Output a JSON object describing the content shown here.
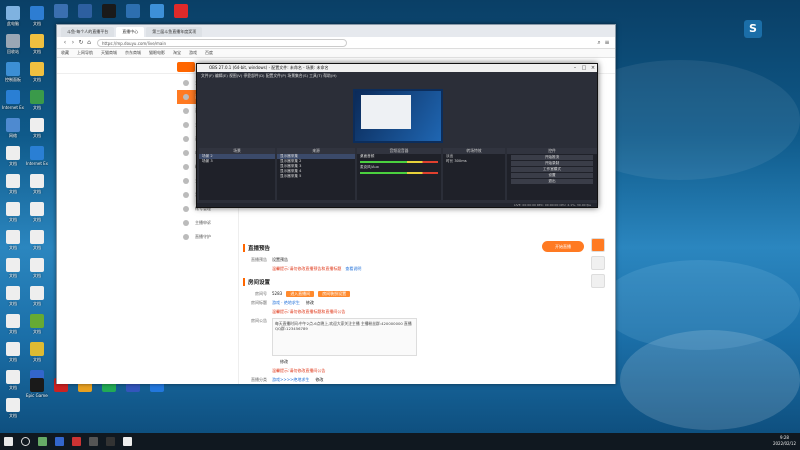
{
  "desktop": {
    "icons": [
      {
        "label": "此电脑",
        "color": "#7fb2e0"
      },
      {
        "label": "回收站",
        "color": "#9aa7b5"
      },
      {
        "label": "控制面板",
        "color": "#3c8fd4"
      },
      {
        "label": "Internet Explorer",
        "color": "#2a7fd4"
      },
      {
        "label": "网络",
        "color": "#4e8ad0"
      },
      {
        "label": "文档",
        "color": "#eeeeee"
      },
      {
        "label": "文档",
        "color": "#eeeeee"
      },
      {
        "label": "文档",
        "color": "#eeeeee"
      },
      {
        "label": "文档",
        "color": "#eeeeee"
      },
      {
        "label": "文档",
        "color": "#eeeeee"
      },
      {
        "label": "文档",
        "color": "#eeeeee"
      },
      {
        "label": "文档",
        "color": "#eeeeee"
      },
      {
        "label": "文档",
        "color": "#eeeeee"
      },
      {
        "label": "文档",
        "color": "#eeeeee"
      },
      {
        "label": "文档",
        "color": "#eeeeee"
      }
    ],
    "col2_icons": [
      {
        "label": "文档",
        "color": "#2d7dd2"
      },
      {
        "label": "文档",
        "color": "#f0c040"
      },
      {
        "label": "文档",
        "color": "#f0c040"
      },
      {
        "label": "文档",
        "color": "#3a9a4a"
      },
      {
        "label": "文档",
        "color": "#eeeeee"
      },
      {
        "label": "Internet Explorer",
        "color": "#2a7fd4"
      },
      {
        "label": "文档",
        "color": "#eeeeee"
      },
      {
        "label": "文档",
        "color": "#eeeeee"
      },
      {
        "label": "文档",
        "color": "#eeeeee"
      },
      {
        "label": "文档",
        "color": "#eeeeee"
      },
      {
        "label": "文档",
        "color": "#eeeeee"
      },
      {
        "label": "文档",
        "color": "#66aa33"
      },
      {
        "label": "文档",
        "color": "#ddbb33"
      },
      {
        "label": "文档",
        "color": "#3366cc"
      }
    ],
    "top_icons": [
      {
        "label": "",
        "color": "#3a6fb0"
      },
      {
        "label": "",
        "color": "#2d5fa0"
      },
      {
        "label": "",
        "color": "#1a1a1a"
      },
      {
        "label": "",
        "color": "#2d6fb0"
      },
      {
        "label": "",
        "color": "#3d90d8"
      },
      {
        "label": "",
        "color": "#e02a2a"
      }
    ],
    "bottom_icons": [
      {
        "label": "Epic Games Launcher",
        "color": "#1a1a1a"
      },
      {
        "label": "",
        "color": "#cc2222"
      },
      {
        "label": "",
        "color": "#e8a020"
      },
      {
        "label": "",
        "color": "#22aa55"
      },
      {
        "label": "",
        "color": "#3355bb"
      },
      {
        "label": "",
        "color": "#2277dd"
      }
    ]
  },
  "browser": {
    "tabs": [
      "斗鱼·每个人的直播平台",
      "直播中心",
      "第三届斗鱼直播年度奖项"
    ],
    "url": "https://mp.douyu.com/live/main",
    "bookmarks": [
      "收藏",
      "上网导航",
      "天猫商城",
      "京东商城",
      "猫眼电影",
      "淘宝",
      "游戏",
      "百度"
    ]
  },
  "site": {
    "sidebar": [
      {
        "label": "主播中心",
        "active": false
      },
      {
        "label": "直播设置",
        "active": true
      },
      {
        "label": "直播间管理",
        "active": false
      },
      {
        "label": "主播任务",
        "active": false
      },
      {
        "label": "直播数据",
        "active": false
      },
      {
        "label": "收益中心",
        "active": false
      },
      {
        "label": "粉丝运营",
        "active": false
      },
      {
        "label": "主播学院",
        "active": false
      },
      {
        "label": "我的账户",
        "active": false
      },
      {
        "label": "帐号管理",
        "active": false
      },
      {
        "label": "主播申诉",
        "active": false
      },
      {
        "label": "直播守护",
        "active": false
      }
    ],
    "section1": {
      "title": "直播预告",
      "label": "直播预告",
      "value": "设置预告",
      "warn": "温馨提示:请勿修改直播预告和直播标题",
      "link": "查看说明"
    },
    "section2": {
      "title": "房间设置",
      "room_label": "房间号",
      "room_no": "5283",
      "btn1": "进入直播间",
      "btn2": "房间装扮设置",
      "name_label": "房间标题",
      "name_value": "游戏 · 绝地求生",
      "name_action": "修改",
      "warn2": "温馨提示:请勿修改直播标题和直播间公告",
      "notice_label": "房间公告",
      "notice_text": "每天直播时间:中午2点-6点晚上,欢迎大家关注主播 主播粉丝群:420000000 直播QQ群:123456789",
      "notice_action": "修改",
      "warn3": "温馨提示:请勿修改直播间公告",
      "cat_label": "直播分类",
      "cat_value": "游戏>>>>绝地求生",
      "cat_action": "修改"
    },
    "start_live": "开始直播"
  },
  "obs": {
    "title": "OBS 27.0.1 (64-bit, windows) - 配置文件: 未命名 - 场景: 未命名",
    "menu": "文件(F)  编辑(E)  视图(V)  停靠部件(D)  配置文件(P)  场景集合(S)  工具(T)  帮助(H)",
    "docks": [
      {
        "title": "场景",
        "items": [
          "场景 2",
          "场景 3"
        ]
      },
      {
        "title": "来源",
        "items": [
          "显示器采集",
          "显示器采集 2",
          "显示器采集 3",
          "显示器采集 4",
          "显示器采集 5"
        ]
      },
      {
        "title": "音频混音器",
        "items": [
          "桌面音频",
          "麦克风/Aux"
        ]
      },
      {
        "title": "转场特效",
        "items": [
          "淡出",
          "时长 300ms"
        ]
      },
      {
        "title": "控件",
        "items": [
          "开始推流",
          "开始录制",
          "工作室模式",
          "设置",
          "退出"
        ]
      }
    ],
    "status": "LIVE: 00:00:00   REC: 00:00:00   CPU: 2.1%, 30.00 fps"
  },
  "taskbar": {
    "time": "9:28",
    "date": "2022/02/12"
  }
}
